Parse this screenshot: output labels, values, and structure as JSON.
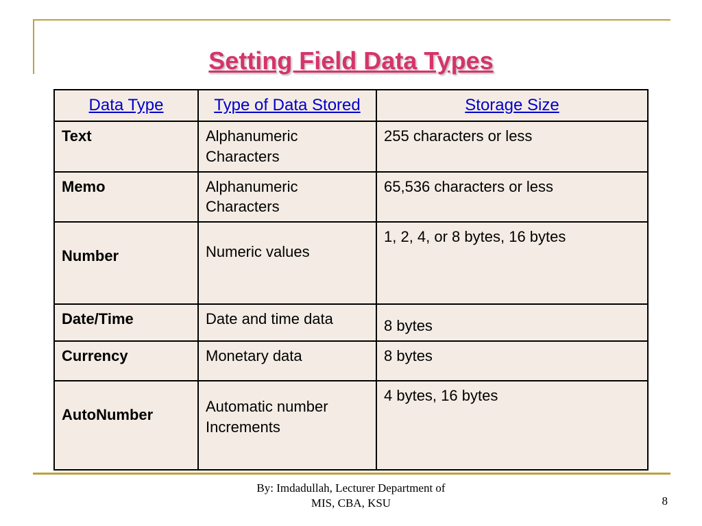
{
  "title": "Setting Field Data  Types",
  "headers": {
    "col1": "Data Type",
    "col2": "Type of Data Stored",
    "col3": "Storage Size"
  },
  "rows": [
    {
      "type": "Text",
      "stored": "Alphanumeric Characters",
      "size": "255 characters or less"
    },
    {
      "type": "Memo",
      "stored": "Alphanumeric Characters",
      "size": "65,536 characters or less"
    },
    {
      "type": "Number",
      "stored": "Numeric values",
      "size": "1, 2, 4, or 8 bytes, 16 bytes"
    },
    {
      "type": "Date/Time",
      "stored": "Date and time data",
      "size": "8 bytes"
    },
    {
      "type": "Currency",
      "stored": "Monetary data",
      "size": "8 bytes"
    },
    {
      "type": "AutoNumber",
      "stored": "Automatic number Increments",
      "size": "4 bytes, 16 bytes"
    }
  ],
  "footer": {
    "line1": "By: Imdadullah, Lecturer Department of",
    "line2": "MIS, CBA, KSU"
  },
  "page_number": "8"
}
